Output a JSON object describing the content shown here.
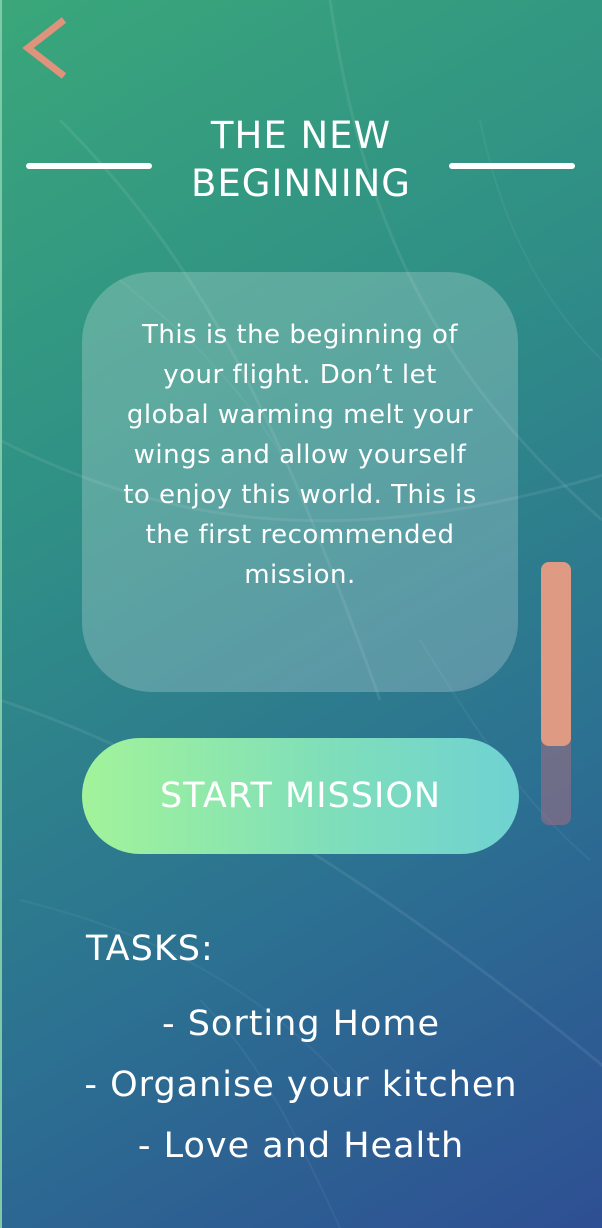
{
  "navigation": {
    "back_icon": "chevron-left-icon",
    "back_color": "#e0937c"
  },
  "header": {
    "title_line1": "THE NEW",
    "title_line2": "BEGINNING"
  },
  "message": {
    "text": "This is the beginning of your flight. Don’t let global warming melt your wings and allow yourself to enjoy this world. This is the first recommended mission."
  },
  "actions": {
    "start_label": "START MISSION"
  },
  "scroll": {
    "position_fraction": 0.0,
    "visible_fraction": 0.7
  },
  "tasks": {
    "heading": "TASKS:",
    "items": [
      "- Sorting Home",
      "- Organise your kitchen",
      "- Love and Health"
    ]
  },
  "colors": {
    "background_start": "#3aa77a",
    "background_end": "#2e4f93",
    "accent": "#df9a83",
    "button_start": "#a2f39a",
    "button_end": "#6fd2d2"
  }
}
